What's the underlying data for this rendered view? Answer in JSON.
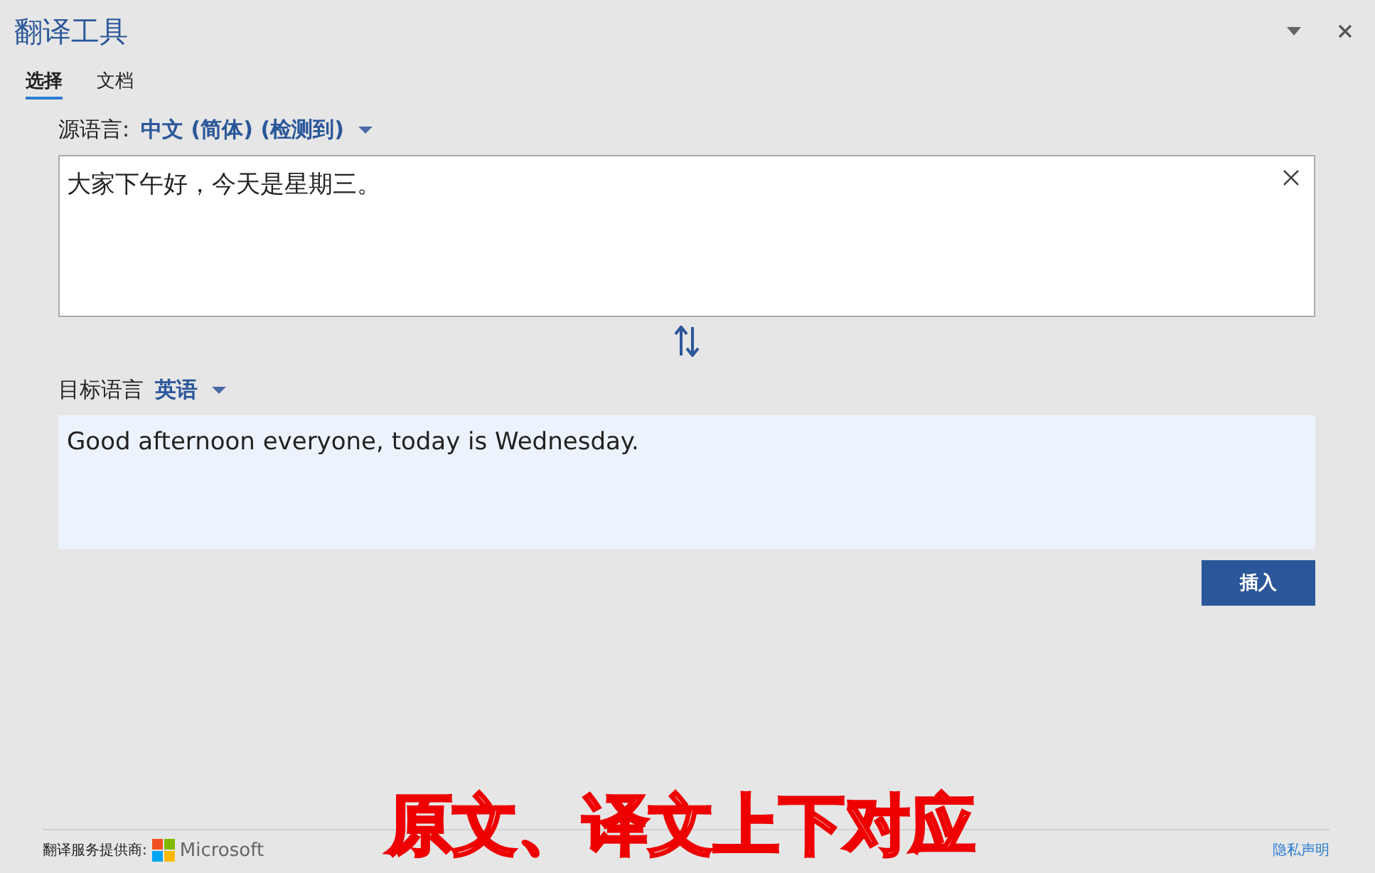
{
  "window": {
    "title": "翻译工具"
  },
  "tabs": [
    {
      "label": "选择",
      "selected": true
    },
    {
      "label": "文档",
      "selected": false
    }
  ],
  "source": {
    "label": "源语言:",
    "language": "中文 (简体) (检测到)",
    "text": "大家下午好，今天是星期三。"
  },
  "target": {
    "label": "目标语言",
    "language": "英语",
    "text": "Good afternoon everyone, today is Wednesday."
  },
  "buttons": [
    "插入"
  ],
  "footer": {
    "provider_label": "翻译服务提供商:",
    "provider": "Microsoft",
    "privacy_link": "隐私声明"
  },
  "caption": "原文、译文上下对应"
}
